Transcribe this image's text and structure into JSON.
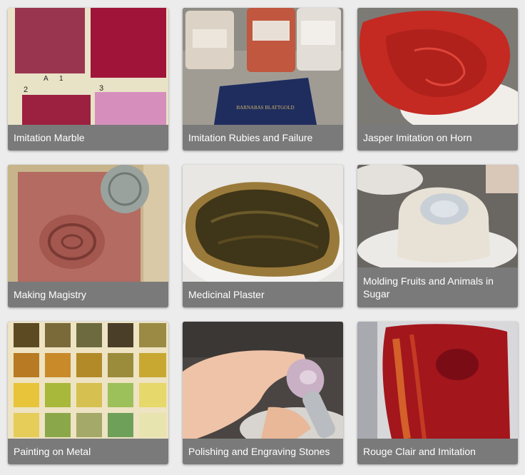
{
  "gallery": {
    "items": [
      {
        "title": "Imitation Marble",
        "image": "painted-sample-swatches"
      },
      {
        "title": "Imitation Rubies and Failure",
        "image": "pigment-jars-and-gold-leaf-book",
        "book_text": "BARNABAS BLATTGOLD"
      },
      {
        "title": "Jasper Imitation on Horn",
        "image": "red-horn-sheet-roll"
      },
      {
        "title": "Making Magistry",
        "image": "clay-mold-impression"
      },
      {
        "title": "Medicinal Plaster",
        "image": "plaster-on-bread"
      },
      {
        "title": "Molding Fruits and Animals in Sugar",
        "image": "sugar-mold-on-plate"
      },
      {
        "title": "Painting on Metal",
        "image": "color-swatch-grid"
      },
      {
        "title": "Polishing and Engraving Stones",
        "image": "hand-engraving-stone"
      },
      {
        "title": "Rouge Clair and Imitation",
        "image": "red-paint-smear"
      }
    ],
    "swatch_labels": [
      "A",
      "1",
      "2",
      "3"
    ]
  }
}
